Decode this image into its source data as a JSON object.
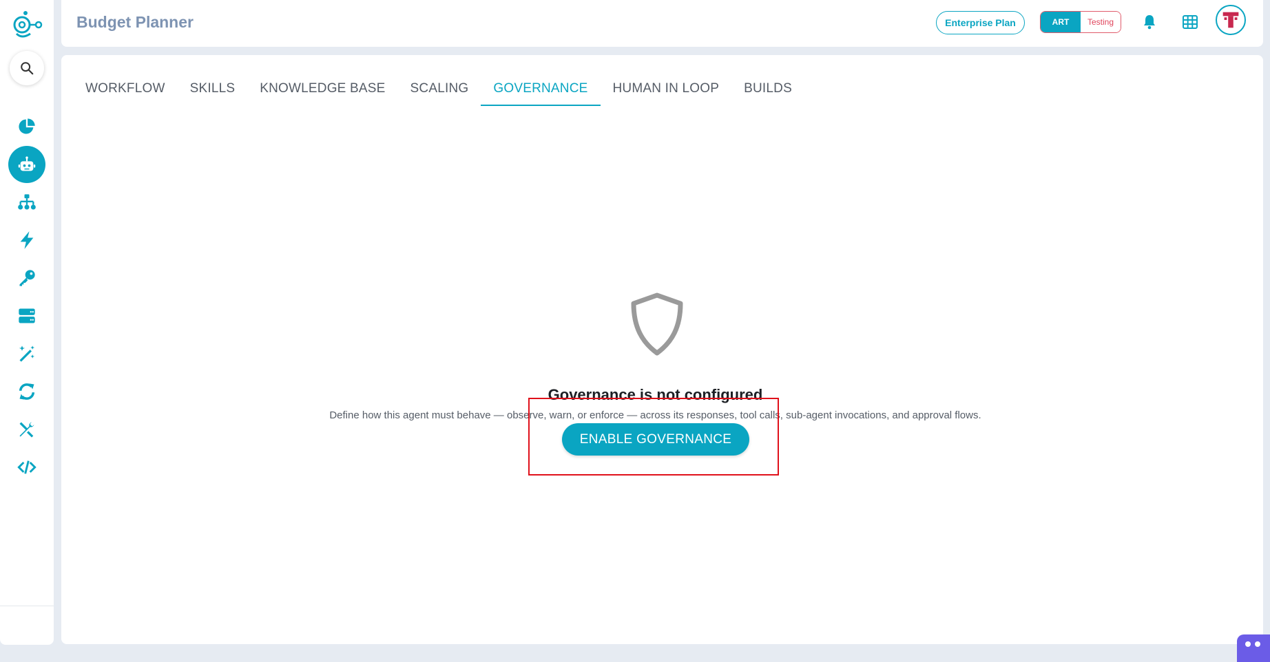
{
  "app": {
    "title": "Budget Planner"
  },
  "header": {
    "plan_label": "Enterprise Plan",
    "env_options": [
      "ART",
      "Testing"
    ],
    "env_selected": "ART",
    "icons": [
      "bell-icon",
      "grid-icon",
      "avatar"
    ]
  },
  "sidebar": {
    "items": [
      {
        "name": "analytics",
        "icon": "pie-chart-icon",
        "active": false
      },
      {
        "name": "agents",
        "icon": "robot-icon",
        "active": true
      },
      {
        "name": "hierarchy",
        "icon": "sitemap-icon",
        "active": false
      },
      {
        "name": "triggers",
        "icon": "bolt-icon",
        "active": false
      },
      {
        "name": "keys",
        "icon": "key-icon",
        "active": false
      },
      {
        "name": "servers",
        "icon": "server-icon",
        "active": false
      },
      {
        "name": "magic",
        "icon": "magic-wand-icon",
        "active": false
      },
      {
        "name": "sync",
        "icon": "sync-icon",
        "active": false
      },
      {
        "name": "tools",
        "icon": "tools-icon",
        "active": false
      },
      {
        "name": "code",
        "icon": "code-icon",
        "active": false
      }
    ]
  },
  "tabs": [
    {
      "label": "WORKFLOW",
      "active": false
    },
    {
      "label": "SKILLS",
      "active": false
    },
    {
      "label": "KNOWLEDGE BASE",
      "active": false
    },
    {
      "label": "SCALING",
      "active": false
    },
    {
      "label": "GOVERNANCE",
      "active": true
    },
    {
      "label": "HUMAN IN LOOP",
      "active": false
    },
    {
      "label": "BUILDS",
      "active": false
    }
  ],
  "empty_state": {
    "icon": "shield-icon",
    "title": "Governance is not configured",
    "description": "Define how this agent must behave — observe, warn, or enforce — across its responses, tool calls, sub-agent invocations, and approval flows.",
    "button_label": "ENABLE GOVERNANCE"
  },
  "colors": {
    "accent": "#0aa5c2",
    "title": "#7d93b2",
    "danger": "#e0435a",
    "highlight": "#e0101a"
  }
}
